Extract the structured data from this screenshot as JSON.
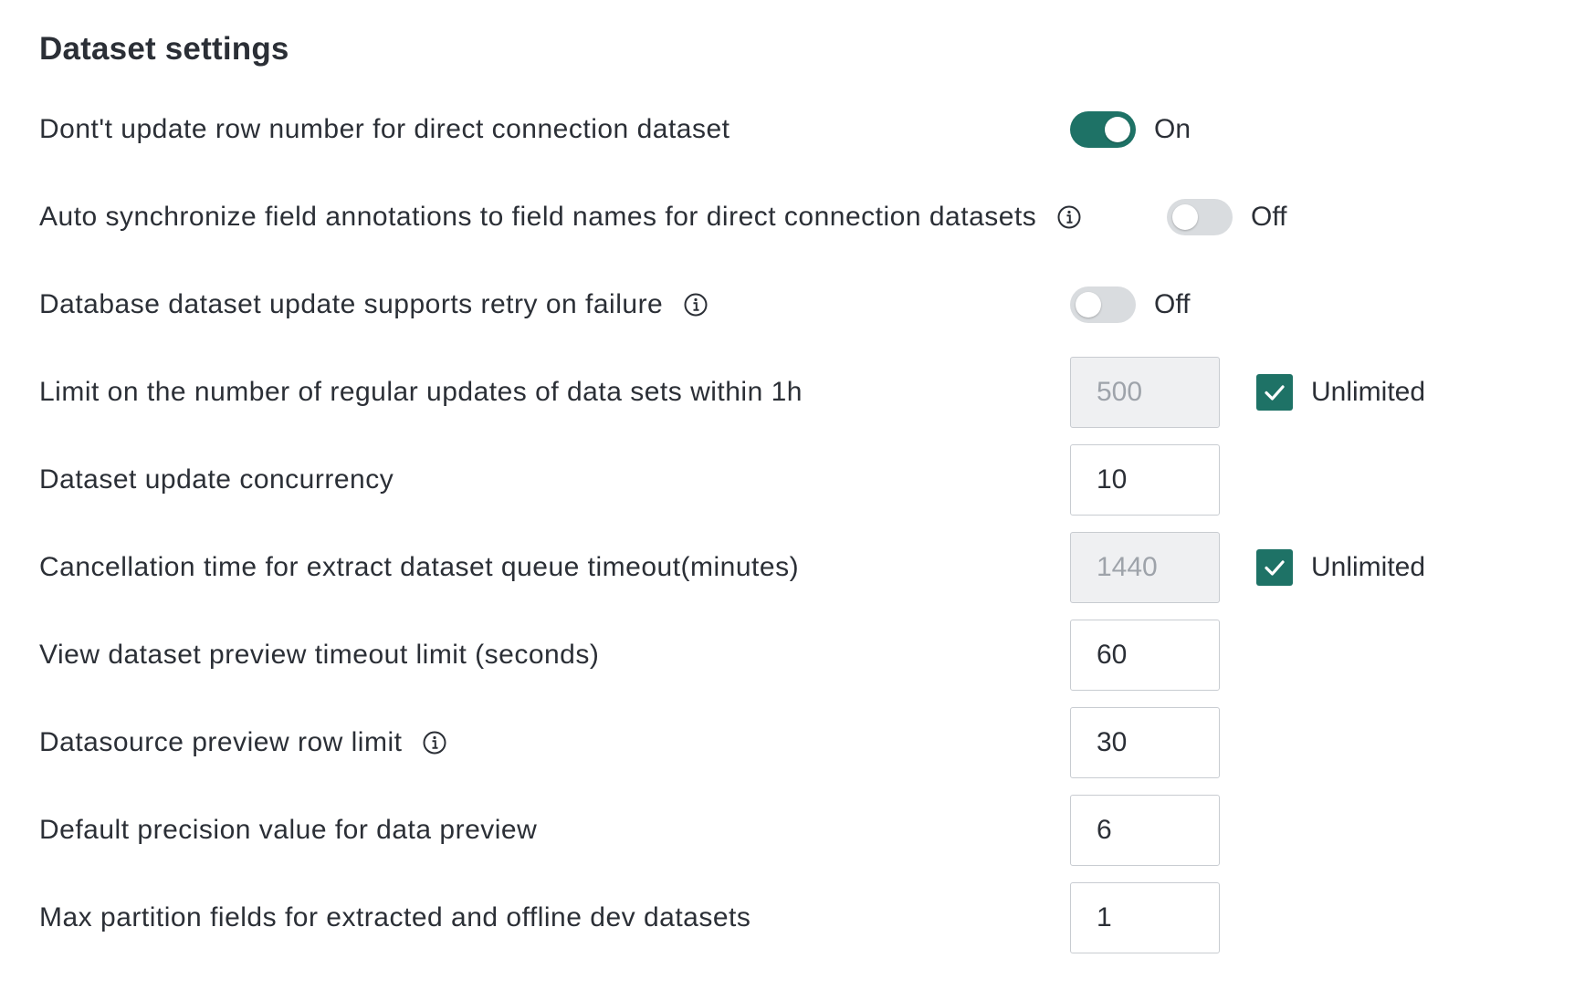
{
  "section": {
    "title": "Dataset settings"
  },
  "colors": {
    "accent": "#1e7266",
    "toggle_off": "#d9dcdf",
    "disabled_bg": "#eff0f2"
  },
  "settings": {
    "no_row_update": {
      "label": "Dont't update row number for direct connection dataset",
      "state": "On",
      "enabled": true
    },
    "auto_sync_annotations": {
      "label": "Auto synchronize field annotations to field names for direct connection datasets",
      "state": "Off",
      "enabled": false,
      "icon": "info-icon"
    },
    "retry_on_failure": {
      "label": "Database dataset update supports retry on failure",
      "state": "Off",
      "enabled": false,
      "icon": "info-icon"
    },
    "regular_update_limit": {
      "label": "Limit on the number of regular updates of data sets within 1h",
      "value": "500",
      "disabled": true,
      "checkbox_label": "Unlimited",
      "checked": true
    },
    "update_concurrency": {
      "label": "Dataset update concurrency",
      "value": "10"
    },
    "queue_timeout": {
      "label": "Cancellation time for extract dataset queue timeout(minutes)",
      "value": "1440",
      "disabled": true,
      "checkbox_label": "Unlimited",
      "checked": true
    },
    "preview_timeout": {
      "label": "View dataset preview timeout limit (seconds)",
      "value": "60"
    },
    "preview_row_limit": {
      "label": "Datasource preview row limit",
      "value": "30",
      "icon": "info-icon"
    },
    "precision": {
      "label": "Default precision value for data preview",
      "value": "6"
    },
    "max_partition_fields": {
      "label": "Max partition fields for extracted and offline dev datasets",
      "value": "1"
    }
  }
}
